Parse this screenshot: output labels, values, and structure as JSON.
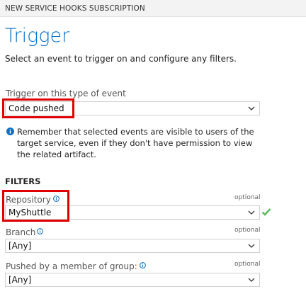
{
  "header": {
    "title": "NEW SERVICE HOOKS SUBSCRIPTION"
  },
  "page": {
    "title": "Trigger",
    "subtitle": "Select an event to trigger on and configure any filters."
  },
  "event": {
    "label": "Trigger on this type of event",
    "value": "Code pushed"
  },
  "info": {
    "icon": "info-icon",
    "text": "Remember that selected events are visible to users of the target service, even if they don't have permission to view the related artifact."
  },
  "filters": {
    "title": "FILTERS",
    "repository": {
      "label": "Repository",
      "optional": "optional",
      "value": "MyShuttle"
    },
    "branch": {
      "label": "Branch",
      "optional": "optional",
      "value": "[Any]"
    },
    "group": {
      "label": "Pushed by a member of group:",
      "optional": "optional",
      "value": "[Any]"
    }
  },
  "colors": {
    "accent": "#0a71c6",
    "highlight": "#e00000",
    "valid": "#5cb85c"
  }
}
